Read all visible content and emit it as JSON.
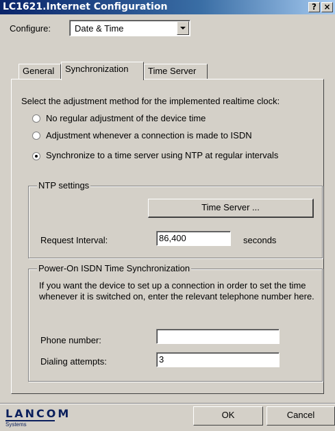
{
  "window": {
    "title": "LC1621.Internet Configuration",
    "help_label": "?",
    "close_label": "×"
  },
  "configure": {
    "label": "Configure:",
    "value": "Date & Time"
  },
  "tabs": [
    {
      "label": "General"
    },
    {
      "label": "Synchronization"
    },
    {
      "label": "Time Server"
    }
  ],
  "sync": {
    "instruction": "Select the adjustment method for the implemented realtime clock:",
    "options": [
      {
        "label": "No regular adjustment of the device time",
        "checked": false
      },
      {
        "label": "Adjustment whenever a connection is made to ISDN",
        "checked": false
      },
      {
        "label": "Synchronize to a time server using NTP at regular intervals",
        "checked": true
      }
    ]
  },
  "ntp": {
    "legend": "NTP settings",
    "time_server_button": "Time Server ...",
    "interval_label": "Request Interval:",
    "interval_value": "86,400",
    "interval_unit": "seconds"
  },
  "poweron": {
    "legend": "Power-On ISDN Time Synchronization",
    "description": "If you want the device to set up a connection in order to set the time whenever it is switched on, enter the relevant telephone number here.",
    "phone_label": "Phone number:",
    "phone_value": "",
    "dialing_label": "Dialing attempts:",
    "dialing_value": "3"
  },
  "footer": {
    "logo_text": "LANCOM",
    "logo_sub": "Systems",
    "ok_label": "OK",
    "cancel_label": "Cancel"
  }
}
